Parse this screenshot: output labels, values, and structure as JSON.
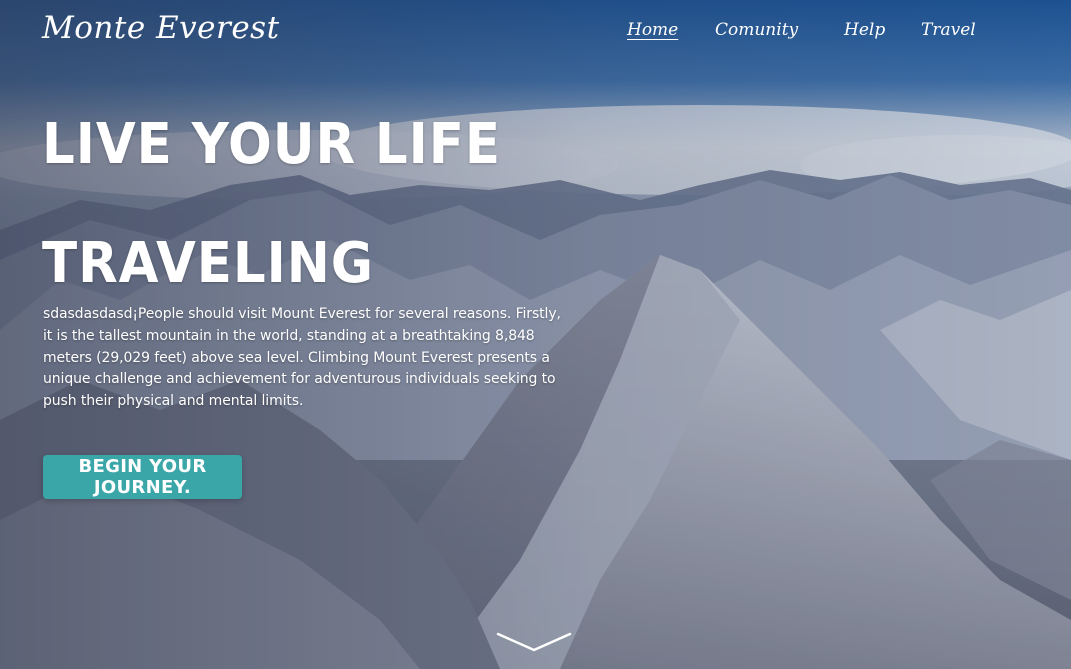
{
  "header": {
    "logo": "Monte Everest",
    "nav": [
      {
        "label": "Home",
        "active": true
      },
      {
        "label": "Comunity",
        "active": false
      },
      {
        "label": "Help",
        "active": false
      },
      {
        "label": "Travel",
        "active": false
      }
    ]
  },
  "hero": {
    "headline_line1": "LIVE YOUR LIFE",
    "headline_line2": "TRAVELING",
    "description": "sdasdasdasd¡People should visit Mount Everest for several reasons. Firstly, it is the tallest mountain in the world, standing at a breathtaking 8,848 meters (29,029 feet) above sea level. Climbing Mount Everest presents a unique challenge and achievement for adventurous individuals seeking to push their physical and mental limits.",
    "cta_label": "BEGIN YOUR JOURNEY.",
    "scroll_icon": "chevron-down-icon",
    "background_image": "snowy-mountain-range-photo"
  },
  "colors": {
    "cta_background": "#3aa6a8",
    "sky_top": "#1f5da0",
    "text": "#ffffff"
  }
}
